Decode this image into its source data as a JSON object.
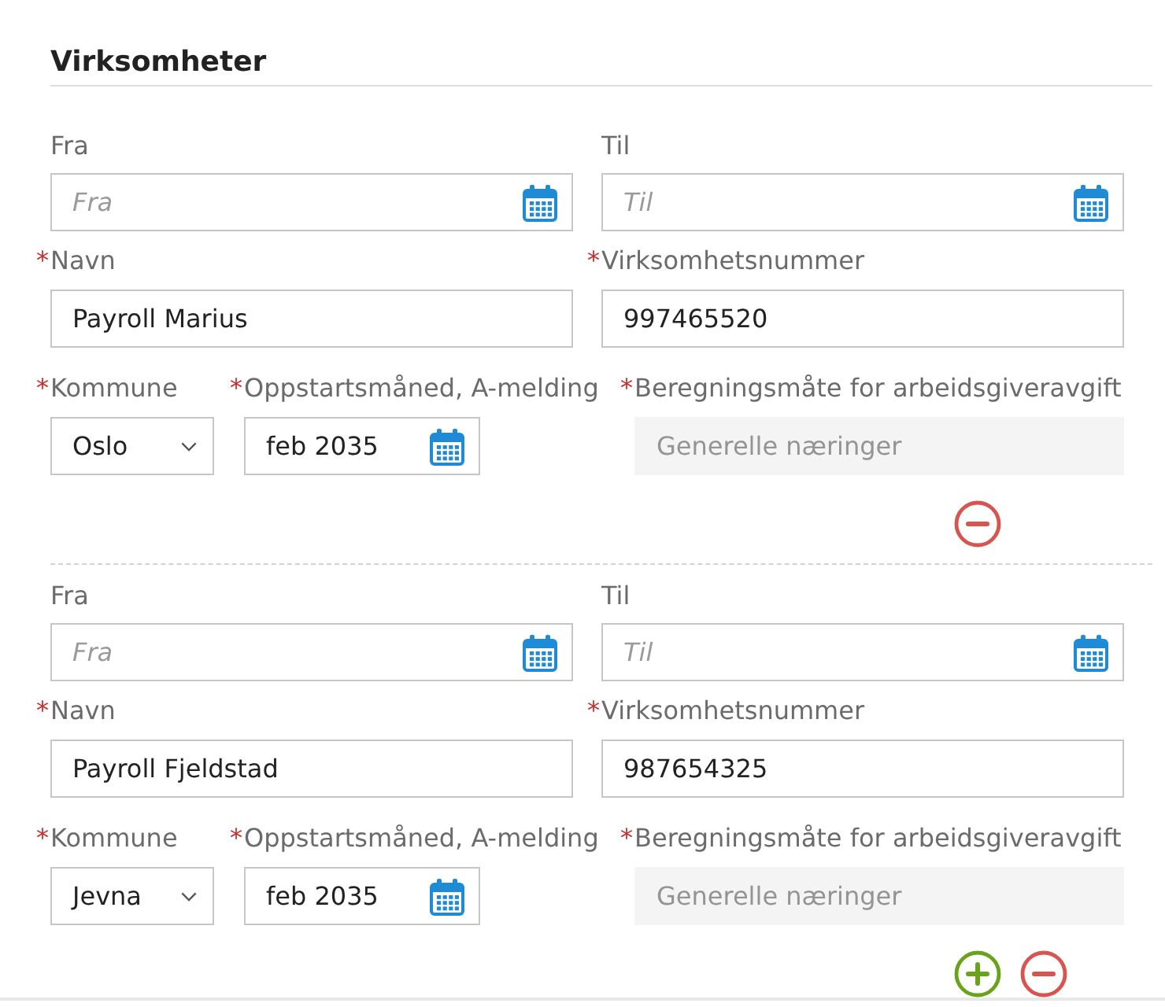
{
  "section": {
    "title": "Virksomheter"
  },
  "blocks": [
    {
      "from": {
        "label": "Fra",
        "placeholder": "Fra"
      },
      "to": {
        "label": "Til",
        "placeholder": "Til"
      },
      "name": {
        "required_mark": "*",
        "label": "Navn",
        "value": "Payroll Marius"
      },
      "org_number": {
        "required_mark": "*",
        "label": "Virksomhetsnummer",
        "value": "997465520"
      },
      "municipality": {
        "required_mark": "*",
        "label": "Kommune",
        "value": "Oslo"
      },
      "start_month": {
        "required_mark": "*",
        "label": "Oppstartsmåned, A-melding",
        "value": "feb 2035"
      },
      "calculation": {
        "required_mark": "*",
        "label": "Beregningsmåte for arbeidsgiveravgift",
        "value": "Generelle næringer",
        "disabled": true
      },
      "actions": [
        {
          "kind": "remove"
        }
      ]
    },
    {
      "from": {
        "label": "Fra",
        "placeholder": "Fra"
      },
      "to": {
        "label": "Til",
        "placeholder": "Til"
      },
      "name": {
        "required_mark": "*",
        "label": "Navn",
        "value": "Payroll Fjeldstad"
      },
      "org_number": {
        "required_mark": "*",
        "label": "Virksomhetsnummer",
        "value": "987654325"
      },
      "municipality": {
        "required_mark": "*",
        "label": "Kommune",
        "value": "Jevna"
      },
      "start_month": {
        "required_mark": "*",
        "label": "Oppstartsmåned, A-melding",
        "value": "feb 2035"
      },
      "calculation": {
        "required_mark": "*",
        "label": "Beregningsmåte for arbeidsgiveravgift",
        "value": "Generelle næringer",
        "disabled": true
      },
      "actions": [
        {
          "kind": "add"
        },
        {
          "kind": "remove"
        }
      ]
    }
  ]
}
